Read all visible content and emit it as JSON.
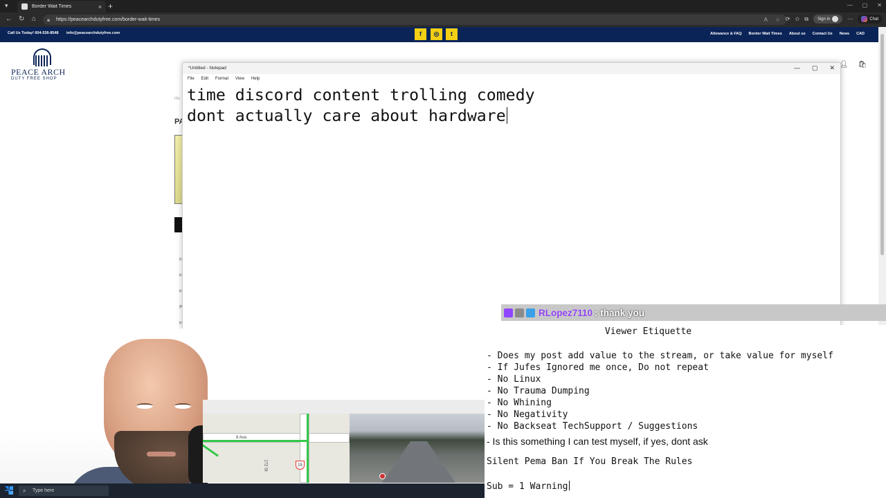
{
  "browser": {
    "tab_title": "Border Wait Times",
    "url": "https://peacearchdutyfree.com/border-wait-times",
    "signin_label": "Sign in",
    "chat_label": "Chat"
  },
  "site": {
    "call": "Call Us Today! 604-536-8548",
    "email": "info@peacearchdutyfree.com",
    "social": [
      {
        "icon": "facebook-icon",
        "glyph": "f"
      },
      {
        "icon": "instagram-icon",
        "glyph": "◎"
      },
      {
        "icon": "twitter-icon",
        "glyph": "t"
      }
    ],
    "nav": [
      "Allowance & FAQ",
      "Border Wait Times",
      "About us",
      "Contact Us",
      "News",
      "CAD"
    ],
    "logo_name": "PEACE ARCH",
    "logo_sub": "DUTY FREE SHOP",
    "page_heading_fragment": "PA",
    "breadcrumb_fragment": "Ho"
  },
  "notepad": {
    "title": "*Untitled - Notepad",
    "menu": [
      "File",
      "Edit",
      "Format",
      "View",
      "Help"
    ],
    "lines": [
      "time discord content trolling comedy",
      "dont actually care about hardware"
    ]
  },
  "chat_alert": {
    "user": "RLopez7110",
    "message": ": thank you"
  },
  "etiquette": {
    "title": "Viewer Etiquette",
    "rules": [
      "- Does my post add value to the stream, or take value for myself",
      "- If Jufes Ignored me once, Do not repeat",
      "- No Linux",
      "- No Trauma Dumping",
      "- No Whining",
      "- No Negativity",
      "- No Backseat TechSupport / Suggestions"
    ],
    "test_rule": "- Is this something I can test myself, if yes, dont ask",
    "ban_notice": "Silent Pema Ban If You Break The Rules",
    "sub_line": "Sub = 1 Warning"
  },
  "map": {
    "labels": [
      "8 Ave.",
      "172 St"
    ],
    "route_number": "15"
  },
  "taskbar": {
    "search_placeholder": "Type here"
  }
}
